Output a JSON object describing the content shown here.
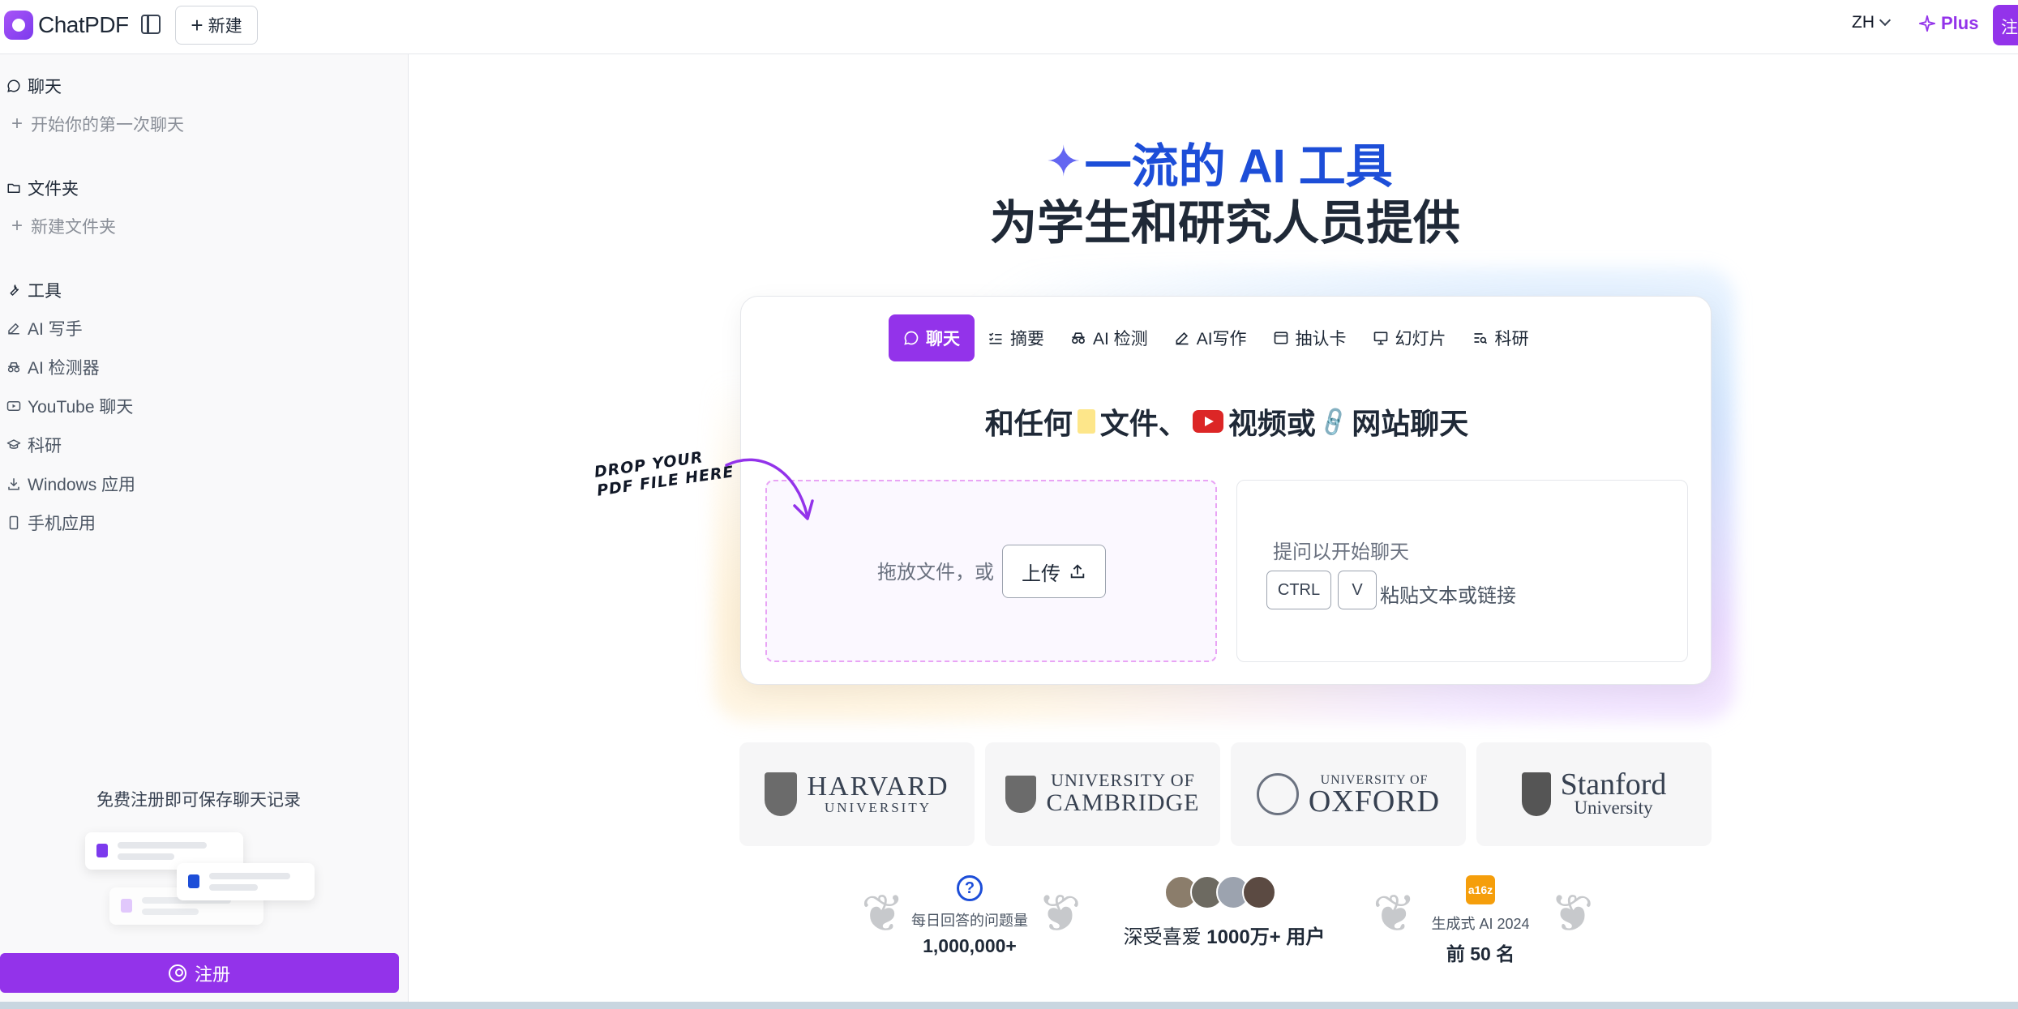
{
  "app": {
    "name": "ChatPDF",
    "brand_color": "#9333ea"
  },
  "topbar": {
    "new_label": "新建",
    "lang_label": "ZH",
    "plus_label": "Plus",
    "signup_label": "注"
  },
  "sidebar": {
    "chat_heading": "聊天",
    "new_chat": "开始你的第一次聊天",
    "folder_heading": "文件夹",
    "new_folder": "新建文件夹",
    "tools_heading": "工具",
    "tools": [
      {
        "label": "AI 写手",
        "icon": "edit-icon"
      },
      {
        "label": "AI 检测器",
        "icon": "detective-icon"
      },
      {
        "label": "YouTube 聊天",
        "icon": "video-icon"
      },
      {
        "label": "科研",
        "icon": "graduation-cap-icon"
      },
      {
        "label": "Windows 应用",
        "icon": "download-icon"
      },
      {
        "label": "手机应用",
        "icon": "phone-icon"
      }
    ],
    "save_note": "免费注册即可保存聊天记录",
    "signup_button": "注册"
  },
  "hero": {
    "line1": "一流的 AI 工具",
    "line2": "为学生和研究人员提供"
  },
  "tabs": [
    {
      "label": "聊天",
      "icon": "chat-bubble-icon",
      "active": true
    },
    {
      "label": "摘要",
      "icon": "checklist-icon",
      "active": false
    },
    {
      "label": "AI 检测",
      "icon": "detective-icon",
      "active": false
    },
    {
      "label": "AI写作",
      "icon": "edit-icon",
      "active": false
    },
    {
      "label": "抽认卡",
      "icon": "card-icon",
      "active": false
    },
    {
      "label": "幻灯片",
      "icon": "presentation-icon",
      "active": false
    },
    {
      "label": "科研",
      "icon": "search-list-icon",
      "active": false
    }
  ],
  "chat_with": {
    "part1": "和任何",
    "part2": "文件、",
    "part3": "视频或",
    "part4": "网站聊天"
  },
  "dropzone": {
    "text": "拖放文件，或",
    "upload_label": "上传",
    "note_line1": "DROP YOUR",
    "note_line2": "PDF FILE HERE"
  },
  "ask": {
    "placeholder": "提问以开始聊天",
    "key1": "CTRL",
    "key2": "V",
    "paste_note": "粘贴文本或链接"
  },
  "universities": [
    {
      "big": "HARVARD",
      "small": "UNIVERSITY"
    },
    {
      "small": "UNIVERSITY OF",
      "big": "CAMBRIDGE"
    },
    {
      "small": "UNIVERSITY OF",
      "big": "OXFORD"
    },
    {
      "big": "Stanford",
      "small": "University"
    }
  ],
  "stats": {
    "questions_label": "每日回答的问题量",
    "questions_value": "1,000,000+",
    "loved_prefix": "深受喜爱",
    "loved_value": "1000万+ 用户",
    "genai_badge": "a16z",
    "genai_label": "生成式 AI 2024",
    "genai_value": "前 50 名"
  }
}
